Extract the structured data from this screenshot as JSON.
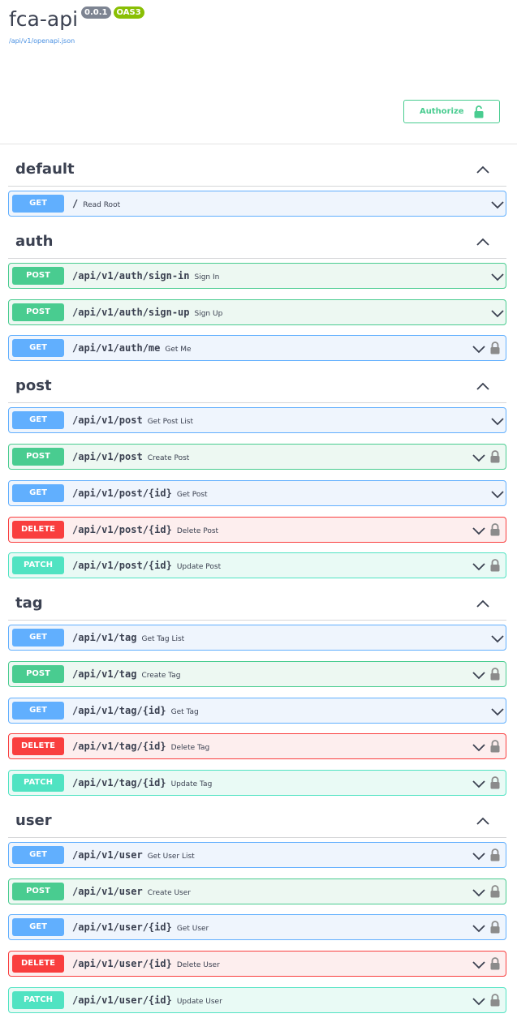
{
  "info": {
    "title": "fca-api",
    "version": "0.0.1",
    "oas": "OAS3",
    "spec_link": "/api/v1/openapi.json"
  },
  "authorize": {
    "label": "Authorize"
  },
  "colors": {
    "get": "#61affe",
    "post": "#49cc90",
    "delete": "#f93e3e",
    "patch": "#50e3c2",
    "text": "#3b4151"
  },
  "tags": [
    {
      "name": "default",
      "ops": [
        {
          "method": "GET",
          "path": "/",
          "summary": "Read Root",
          "locked": false
        }
      ]
    },
    {
      "name": "auth",
      "ops": [
        {
          "method": "POST",
          "path": "/api/v1/auth/sign-in",
          "summary": "Sign In",
          "locked": false
        },
        {
          "method": "POST",
          "path": "/api/v1/auth/sign-up",
          "summary": "Sign Up",
          "locked": false
        },
        {
          "method": "GET",
          "path": "/api/v1/auth/me",
          "summary": "Get Me",
          "locked": true
        }
      ]
    },
    {
      "name": "post",
      "ops": [
        {
          "method": "GET",
          "path": "/api/v1/post",
          "summary": "Get Post List",
          "locked": false
        },
        {
          "method": "POST",
          "path": "/api/v1/post",
          "summary": "Create Post",
          "locked": true
        },
        {
          "method": "GET",
          "path": "/api/v1/post/{id}",
          "summary": "Get Post",
          "locked": false
        },
        {
          "method": "DELETE",
          "path": "/api/v1/post/{id}",
          "summary": "Delete Post",
          "locked": true
        },
        {
          "method": "PATCH",
          "path": "/api/v1/post/{id}",
          "summary": "Update Post",
          "locked": true
        }
      ]
    },
    {
      "name": "tag",
      "ops": [
        {
          "method": "GET",
          "path": "/api/v1/tag",
          "summary": "Get Tag List",
          "locked": false
        },
        {
          "method": "POST",
          "path": "/api/v1/tag",
          "summary": "Create Tag",
          "locked": true
        },
        {
          "method": "GET",
          "path": "/api/v1/tag/{id}",
          "summary": "Get Tag",
          "locked": false
        },
        {
          "method": "DELETE",
          "path": "/api/v1/tag/{id}",
          "summary": "Delete Tag",
          "locked": true
        },
        {
          "method": "PATCH",
          "path": "/api/v1/tag/{id}",
          "summary": "Update Tag",
          "locked": true
        }
      ]
    },
    {
      "name": "user",
      "ops": [
        {
          "method": "GET",
          "path": "/api/v1/user",
          "summary": "Get User List",
          "locked": true
        },
        {
          "method": "POST",
          "path": "/api/v1/user",
          "summary": "Create User",
          "locked": true
        },
        {
          "method": "GET",
          "path": "/api/v1/user/{id}",
          "summary": "Get User",
          "locked": true
        },
        {
          "method": "DELETE",
          "path": "/api/v1/user/{id}",
          "summary": "Delete User",
          "locked": true
        },
        {
          "method": "PATCH",
          "path": "/api/v1/user/{id}",
          "summary": "Update User",
          "locked": true
        }
      ]
    }
  ]
}
